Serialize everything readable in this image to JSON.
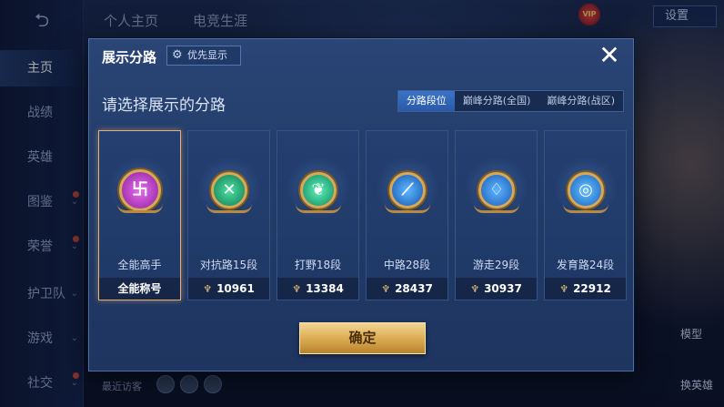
{
  "top_tabs": [
    "个人主页",
    "电竞生涯"
  ],
  "settings_label": "设置",
  "vip_label": "VIP",
  "sidebar": {
    "back": "⮌",
    "items": [
      {
        "label": "主页",
        "active": true,
        "chevron": false,
        "dot": false
      },
      {
        "label": "战绩",
        "active": false,
        "chevron": false,
        "dot": false
      },
      {
        "label": "英雄",
        "active": false,
        "chevron": false,
        "dot": false
      },
      {
        "label": "图鉴",
        "active": false,
        "chevron": true,
        "dot": true
      },
      {
        "label": "荣誉",
        "active": false,
        "chevron": true,
        "dot": true
      },
      {
        "label": "护卫队",
        "active": false,
        "chevron": true,
        "dot": false
      },
      {
        "label": "游戏",
        "active": false,
        "chevron": true,
        "dot": false
      },
      {
        "label": "社交",
        "active": false,
        "chevron": true,
        "dot": true
      }
    ]
  },
  "right_buttons": {
    "model": "模型",
    "switch_hero": "换英雄"
  },
  "visitors_label": "最近访客",
  "dialog": {
    "title": "展示分路",
    "priority_label": "优先显示",
    "close": "✕",
    "subtitle": "请选择展示的分路",
    "tabs": [
      {
        "label": "分路段位",
        "active": true
      },
      {
        "label": "巅峰分路(全国)",
        "active": false
      },
      {
        "label": "巅峰分路(战区)",
        "active": false
      }
    ],
    "cards": [
      {
        "name": "全能高手",
        "foot": "全能称号",
        "points": null,
        "emblem": "allround",
        "glyph": "卐",
        "selected": true
      },
      {
        "name": "对抗路15段",
        "foot": "10961",
        "points": "♆",
        "emblem": "top",
        "glyph": "✕",
        "selected": false
      },
      {
        "name": "打野18段",
        "foot": "13384",
        "points": "♆",
        "emblem": "jungle",
        "glyph": "❦",
        "selected": false
      },
      {
        "name": "中路28段",
        "foot": "28437",
        "points": "♆",
        "emblem": "mid",
        "glyph": "⟋",
        "selected": false
      },
      {
        "name": "游走29段",
        "foot": "30937",
        "points": "♆",
        "emblem": "support",
        "glyph": "♢",
        "selected": false
      },
      {
        "name": "发育路24段",
        "foot": "22912",
        "points": "♆",
        "emblem": "adc",
        "glyph": "◎",
        "selected": false
      }
    ],
    "confirm_label": "确定"
  }
}
